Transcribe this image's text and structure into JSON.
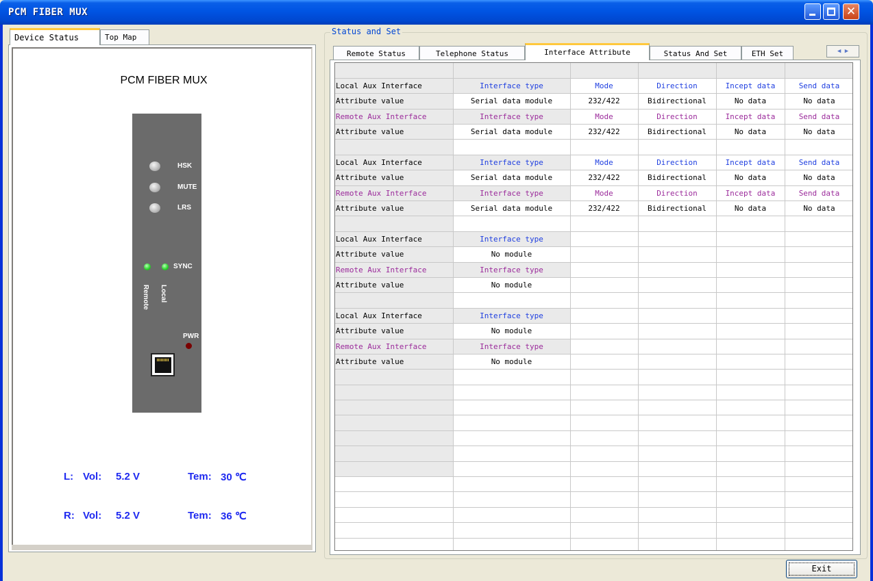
{
  "window": {
    "title": "PCM FIBER MUX"
  },
  "left_tabs": [
    "Device Status",
    "Top Map"
  ],
  "device": {
    "title": "PCM FIBER MUX",
    "labels": {
      "hsk": "HSK",
      "mute": "MUTE",
      "lrs": "LRS",
      "sync": "SYNC",
      "remote": "Remote",
      "local": "Local",
      "pwr": "PWR"
    },
    "local": {
      "prefix": "L:",
      "vol_label": "Vol:",
      "vol": "5.2 V",
      "tem_label": "Tem:",
      "tem": "30 ℃"
    },
    "remote": {
      "prefix": "R:",
      "vol_label": "Vol:",
      "vol": "5.2 V",
      "tem_label": "Tem:",
      "tem": "36 ℃"
    }
  },
  "group_title": "Status and Set",
  "right_tabs": [
    "Remote Status",
    "Telephone Status",
    "Interface Attribute",
    "Status And Set",
    "ETH Set"
  ],
  "active_tab": "Interface Attribute",
  "tab_scroll_glyph": "◀ ▶",
  "grid_rows": [
    {
      "kind": "header",
      "cells": [
        "",
        "",
        "",
        "",
        "",
        ""
      ]
    },
    {
      "kind": "local",
      "cells": [
        "Local Aux Interface",
        "Interface type",
        "Mode",
        "Direction",
        "Incept data",
        "Send data"
      ]
    },
    {
      "kind": "value",
      "cells": [
        "Attribute value",
        "Serial data module",
        "232/422",
        "Bidirectional",
        "No data",
        "No data"
      ]
    },
    {
      "kind": "remote",
      "cells": [
        "Remote Aux Interface",
        "Interface type",
        "Mode",
        "Direction",
        "Incept data",
        "Send data"
      ]
    },
    {
      "kind": "value",
      "cells": [
        "Attribute value",
        "Serial data module",
        "232/422",
        "Bidirectional",
        "No data",
        "No data"
      ]
    },
    {
      "kind": "blank",
      "cells": [
        "",
        "",
        "",
        "",
        "",
        ""
      ]
    },
    {
      "kind": "local",
      "cells": [
        "Local Aux Interface",
        "Interface type",
        "Mode",
        "Direction",
        "Incept data",
        "Send data"
      ]
    },
    {
      "kind": "value",
      "cells": [
        "Attribute value",
        "Serial data module",
        "232/422",
        "Bidirectional",
        "No data",
        "No data"
      ]
    },
    {
      "kind": "remote",
      "cells": [
        "Remote Aux Interface",
        "Interface type",
        "Mode",
        "Direction",
        "Incept data",
        "Send data"
      ]
    },
    {
      "kind": "value",
      "cells": [
        "Attribute value",
        "Serial data module",
        "232/422",
        "Bidirectional",
        "No data",
        "No data"
      ]
    },
    {
      "kind": "blank",
      "cells": [
        "",
        "",
        "",
        "",
        "",
        ""
      ]
    },
    {
      "kind": "local",
      "cells": [
        "Local Aux Interface",
        "Interface type",
        "",
        "",
        "",
        ""
      ]
    },
    {
      "kind": "value",
      "cells": [
        "Attribute value",
        "No module",
        "",
        "",
        "",
        ""
      ]
    },
    {
      "kind": "remote",
      "cells": [
        "Remote Aux Interface",
        "Interface type",
        "",
        "",
        "",
        ""
      ]
    },
    {
      "kind": "value",
      "cells": [
        "Attribute value",
        "No module",
        "",
        "",
        "",
        ""
      ]
    },
    {
      "kind": "blank",
      "cells": [
        "",
        "",
        "",
        "",
        "",
        ""
      ]
    },
    {
      "kind": "local",
      "cells": [
        "Local Aux Interface",
        "Interface type",
        "",
        "",
        "",
        ""
      ]
    },
    {
      "kind": "value",
      "cells": [
        "Attribute value",
        "No module",
        "",
        "",
        "",
        ""
      ]
    },
    {
      "kind": "remote",
      "cells": [
        "Remote Aux Interface",
        "Interface type",
        "",
        "",
        "",
        ""
      ]
    },
    {
      "kind": "value",
      "cells": [
        "Attribute value",
        "No module",
        "",
        "",
        "",
        ""
      ]
    },
    {
      "kind": "empty",
      "cells": [
        "",
        "",
        "",
        "",
        "",
        ""
      ]
    },
    {
      "kind": "empty",
      "cells": [
        "",
        "",
        "",
        "",
        "",
        ""
      ]
    },
    {
      "kind": "empty",
      "cells": [
        "",
        "",
        "",
        "",
        "",
        ""
      ]
    },
    {
      "kind": "empty",
      "cells": [
        "",
        "",
        "",
        "",
        "",
        ""
      ]
    },
    {
      "kind": "empty",
      "cells": [
        "",
        "",
        "",
        "",
        "",
        ""
      ]
    },
    {
      "kind": "empty",
      "cells": [
        "",
        "",
        "",
        "",
        "",
        ""
      ]
    },
    {
      "kind": "empty",
      "cells": [
        "",
        "",
        "",
        "",
        "",
        ""
      ]
    },
    {
      "kind": "plain",
      "cells": [
        "",
        "",
        "",
        "",
        "",
        ""
      ]
    },
    {
      "kind": "plain",
      "cells": [
        "",
        "",
        "",
        "",
        "",
        ""
      ]
    },
    {
      "kind": "plain",
      "cells": [
        "",
        "",
        "",
        "",
        "",
        ""
      ]
    },
    {
      "kind": "plain",
      "cells": [
        "",
        "",
        "",
        "",
        "",
        ""
      ]
    },
    {
      "kind": "plain",
      "cells": [
        "",
        "",
        "",
        "",
        "",
        ""
      ]
    }
  ],
  "exit_label": "Exit"
}
